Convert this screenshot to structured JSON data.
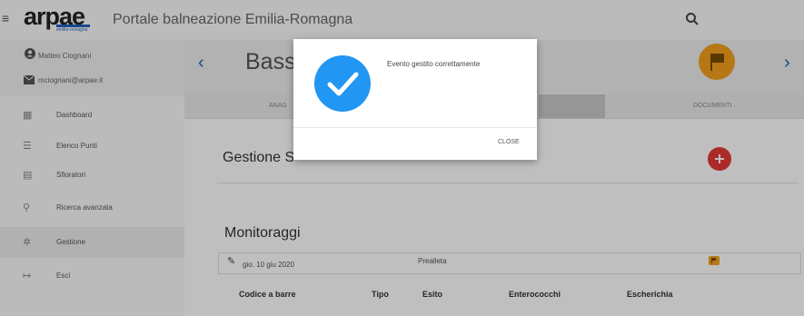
{
  "header": {
    "menu_glyph": "≡",
    "logo_text": "arpae",
    "logo_subtext": "emilia-romagna",
    "app_title": "Portale balneazione Emilia-Romagna",
    "search_icon": "search-icon"
  },
  "user": {
    "name": "Matteo Ciognani",
    "email": "mciognani@arpae.it"
  },
  "sidebar": {
    "items": [
      {
        "label": "Dashboard",
        "icon": "dashboard-icon",
        "glyph": "▦"
      },
      {
        "label": "Elenco Punti",
        "icon": "list-icon",
        "glyph": "☰"
      },
      {
        "label": "Sfioratori",
        "icon": "grid-icon",
        "glyph": "▤"
      },
      {
        "label": "Ricerca avanzata",
        "icon": "search-icon",
        "glyph": "⚲"
      },
      {
        "label": "Gestione",
        "icon": "gear-icon",
        "glyph": "✲"
      },
      {
        "label": "Esci",
        "icon": "logout-icon",
        "glyph": "↦"
      }
    ]
  },
  "main": {
    "prev_glyph": "‹",
    "next_glyph": "›",
    "point_title": "Basso",
    "tabs": [
      "ANAG",
      "DOCUMENTI"
    ],
    "gestione_title": "Gestione S",
    "monitoraggi_title": "Monitoraggi",
    "monitor_row": {
      "date": "gio. 10 giu 2020",
      "status": "Prealleta"
    },
    "table_headers": [
      "Codice a barre",
      "Tipo",
      "Esito",
      "Enterococchi",
      "Escherichia"
    ]
  },
  "modal": {
    "message": "Evento gestito correttamente",
    "close_label": "CLOSE"
  },
  "colors": {
    "accent_blue": "#2196f3",
    "brand_blue": "#1f5fbf",
    "flag_orange": "#f3a11d",
    "add_red": "#e53935"
  }
}
